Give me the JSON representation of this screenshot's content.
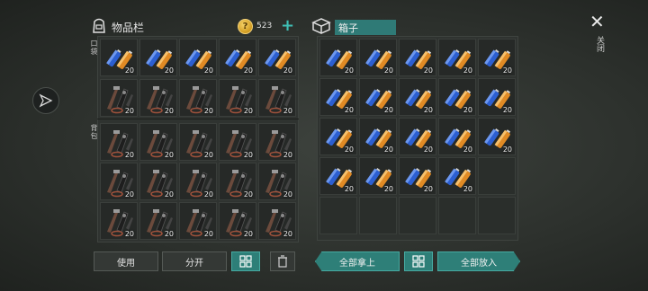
{
  "inventory": {
    "title": "物品栏",
    "coins": "523",
    "section_pocket": "口袋",
    "section_backpack": "背包",
    "pocket_qty": [
      "20",
      "20",
      "20",
      "20",
      "20",
      "20",
      "20",
      "20",
      "20",
      "20"
    ],
    "backpack_qty": [
      "20",
      "20",
      "20",
      "20",
      "20",
      "20",
      "20",
      "20",
      "20",
      "20",
      "20",
      "20",
      "20",
      "20",
      "20"
    ]
  },
  "box": {
    "title": "箱子",
    "qty": [
      "20",
      "20",
      "20",
      "20",
      "20",
      "20",
      "20",
      "20",
      "20",
      "20",
      "20",
      "20",
      "20",
      "20",
      "20",
      "20",
      "20",
      "20",
      "20"
    ]
  },
  "buttons": {
    "use": "使用",
    "split": "分开",
    "take_all": "全部拿上",
    "put_all": "全部放入"
  },
  "close_label": "关闭",
  "colors": {
    "accent": "#2e7f78",
    "coin": "#e0ac2a"
  },
  "icons": {
    "battery": "battery-icon",
    "tools": "tool-kit-icon"
  }
}
